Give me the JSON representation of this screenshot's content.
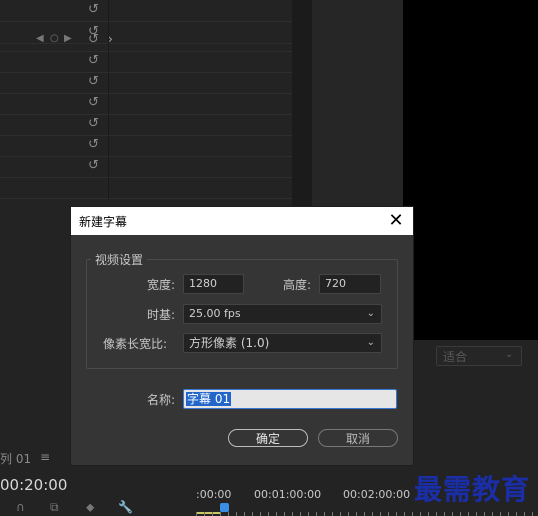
{
  "dialog": {
    "title": "新建字幕",
    "close_glyph": "✕",
    "group_label": "视频设置",
    "width_label": "宽度:",
    "width_value": "1280",
    "height_label": "高度:",
    "height_value": "720",
    "timebase_label": "时基:",
    "timebase_value": "25.00 fps",
    "pixel_aspect_label": "像素长宽比:",
    "pixel_aspect_value": "方形像素 (1.0)",
    "name_label": "名称:",
    "name_value": "字幕 01",
    "ok_label": "确定",
    "cancel_label": "取消"
  },
  "background": {
    "fit_dropdown_value": "适合",
    "sequence_label": "列 01",
    "timecode": "00:20:00",
    "ruler_labels": [
      ":00:00",
      "00:01:00:00",
      "00:02:00:00"
    ]
  },
  "watermark": "最需教育",
  "colors": {
    "dialog_bg": "#353535",
    "titlebar": "#ffffff",
    "selection": "#2266cc",
    "watermark": "#1a2ea8"
  }
}
